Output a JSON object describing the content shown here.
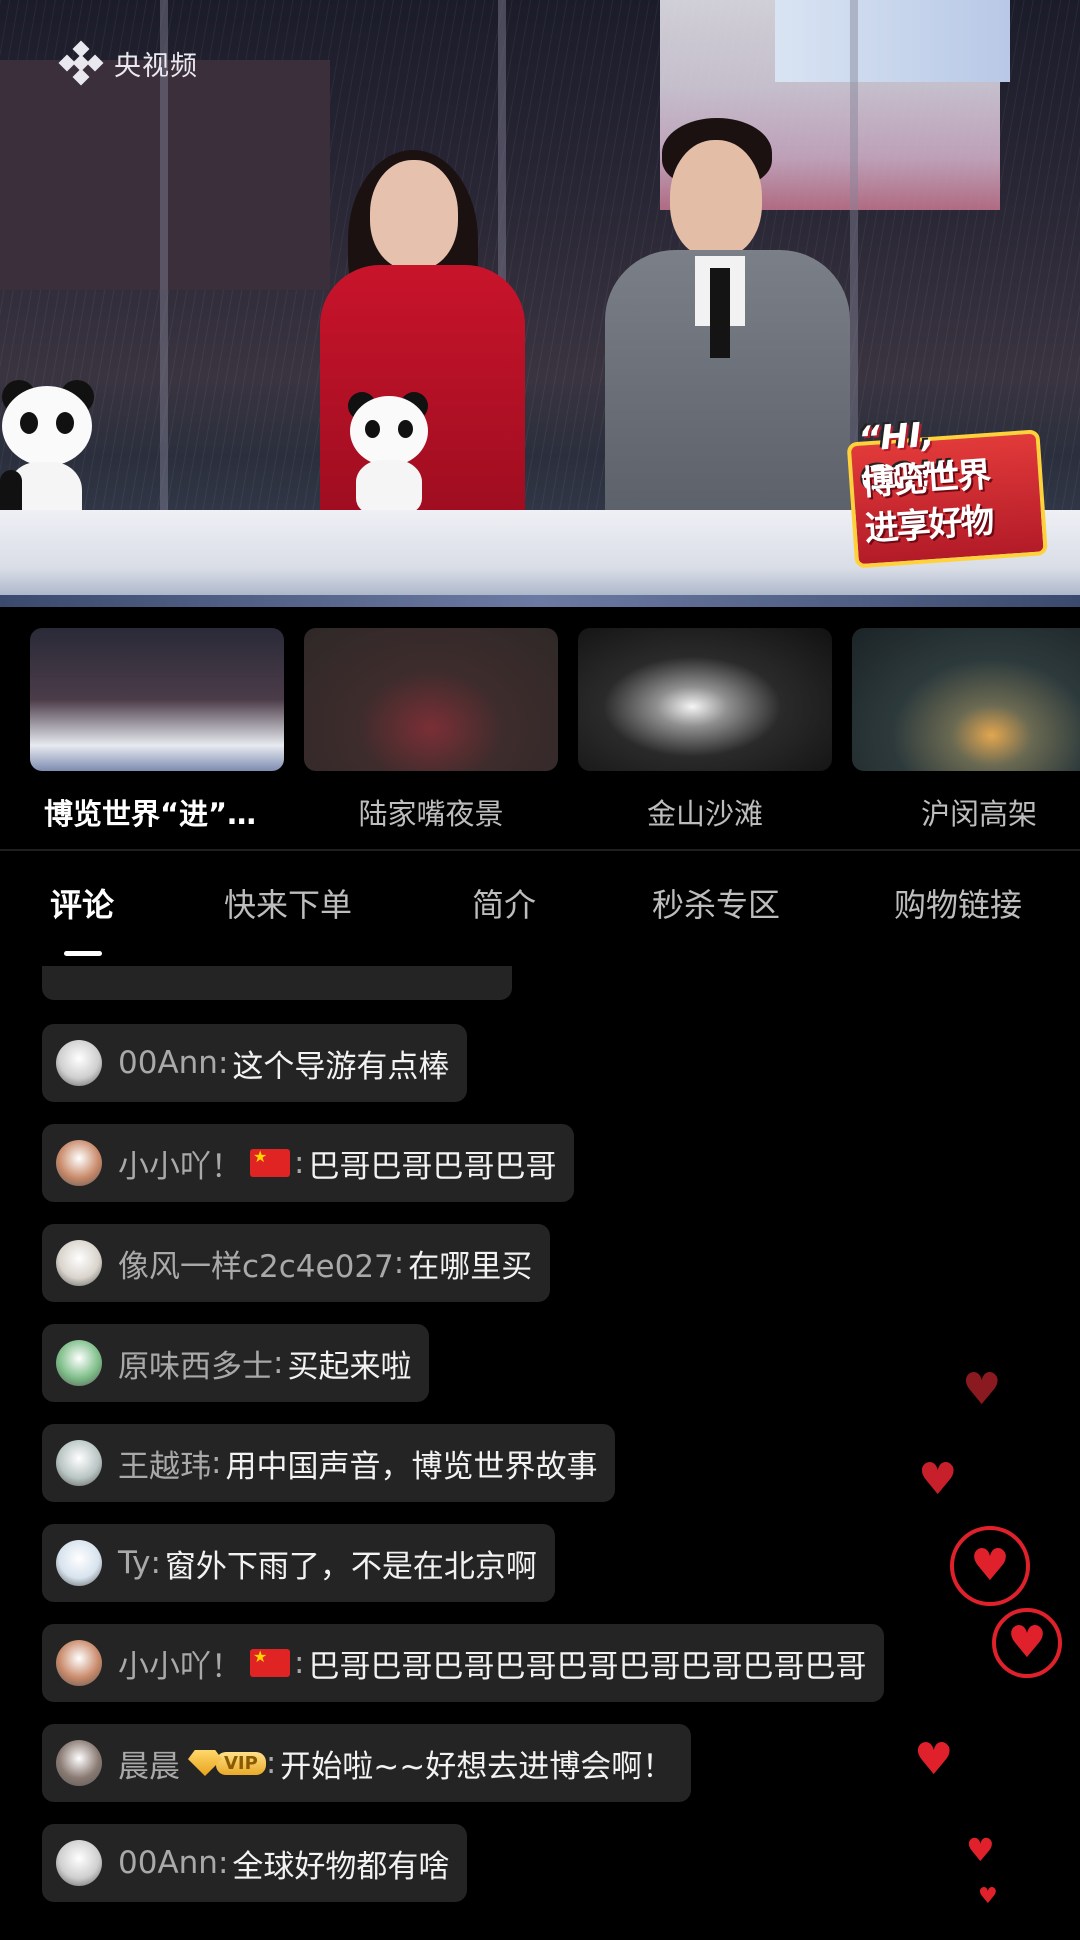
{
  "video": {
    "logo_text": "央视频",
    "badge_hi": "“HI, GO!”",
    "badge_line1": "博览世界",
    "badge_line2": "进享好物"
  },
  "channels": [
    {
      "name": "博览世界“进”…",
      "active": true
    },
    {
      "name": "陆家嘴夜景",
      "active": false
    },
    {
      "name": "金山沙滩",
      "active": false
    },
    {
      "name": "沪闵高架",
      "active": false
    }
  ],
  "tabs": [
    {
      "label": "评论",
      "active": true
    },
    {
      "label": "快来下单",
      "active": false
    },
    {
      "label": "简介",
      "active": false
    },
    {
      "label": "秒杀专区",
      "active": false
    },
    {
      "label": "购物链接",
      "active": false
    }
  ],
  "comments": [
    {
      "user": "00Ann",
      "text": "这个导游有点棒",
      "avatar_color": "#cfcfcf"
    },
    {
      "user": "小小吖！",
      "flag": true,
      "text": "巴哥巴哥巴哥巴哥",
      "avatar_color": "#c98a6a"
    },
    {
      "user": "像风一样c2c4e027",
      "text": "在哪里买",
      "avatar_color": "#d9d4cc"
    },
    {
      "user": "原味西多士",
      "text": "买起来啦",
      "avatar_color": "#7fbf8a"
    },
    {
      "user": "王越玮",
      "text": "用中国声音，博览世界故事",
      "avatar_color": "#b9c6c4"
    },
    {
      "user": "Ty",
      "text": "窗外下雨了，不是在北京啊",
      "avatar_color": "#d7e3ee"
    },
    {
      "user": "小小吖！",
      "flag": true,
      "text": "巴哥巴哥巴哥巴哥巴哥巴哥巴哥巴哥巴哥",
      "avatar_color": "#c98a6a"
    },
    {
      "user": "晨晨",
      "vip": "VIP",
      "text": "开始啦~~好想去进博会啊！",
      "avatar_color": "#8a7a73"
    },
    {
      "user": "00Ann",
      "text": "全球好物都有啥",
      "avatar_color": "#cfcfcf"
    }
  ],
  "colors": {
    "background": "#000000",
    "bubble": "#242424",
    "heart": "#e0212c",
    "username": "#a9a9a9"
  }
}
